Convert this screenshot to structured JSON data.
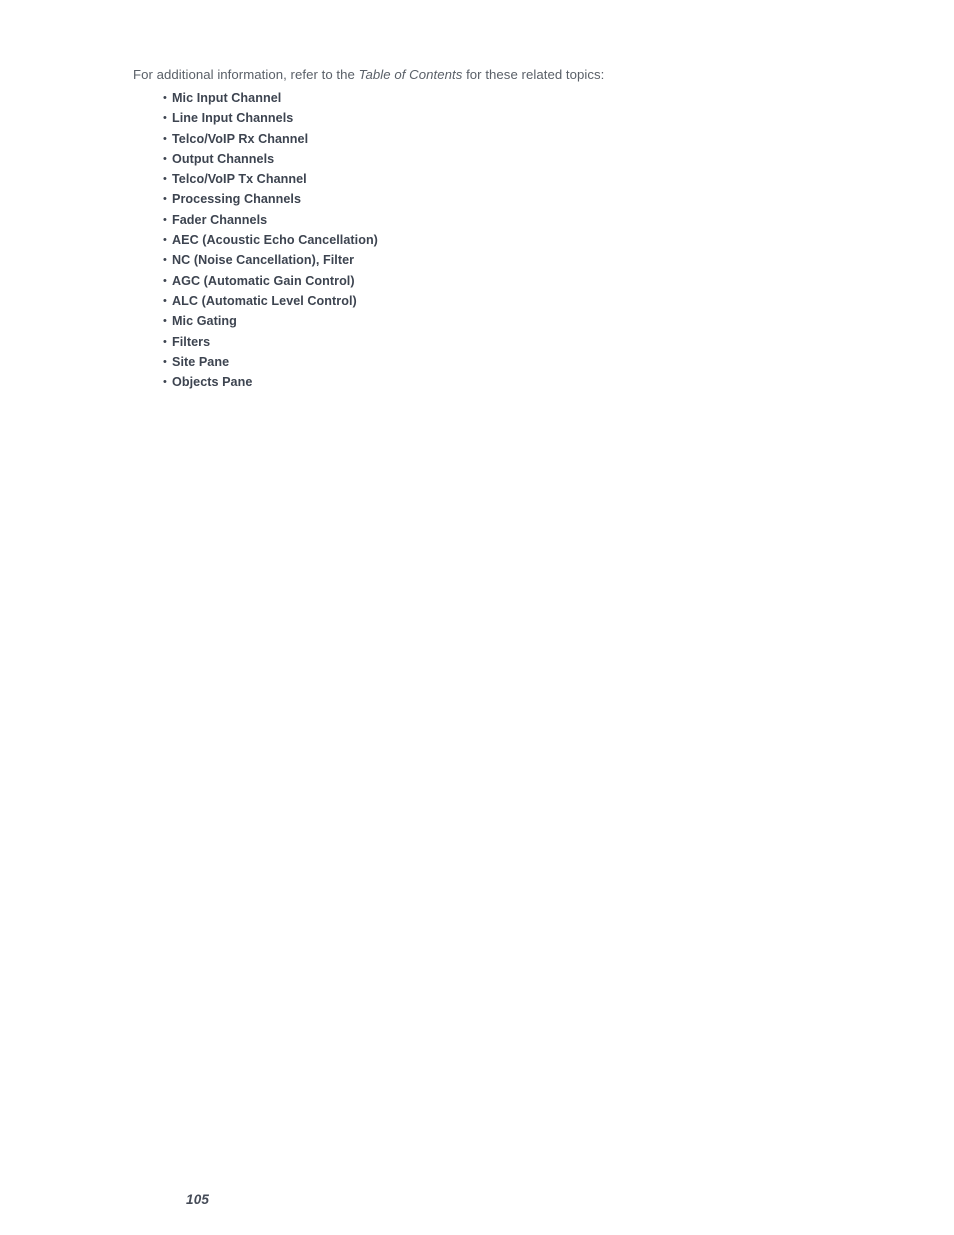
{
  "document": {
    "page_number": "105",
    "background_color": "#ffffff",
    "body_text_color": "#5a6068",
    "heading_text_color": "#3d4450"
  },
  "intro": {
    "before_emphasis": "For additional information, refer to the ",
    "emphasis": "Table of Contents",
    "after_emphasis": " for these related topics:"
  },
  "topics": {
    "bullet_glyph": "•",
    "items": [
      {
        "label": "Mic Input Channel"
      },
      {
        "label": "Line Input Channels"
      },
      {
        "label": "Telco/VoIP Rx Channel"
      },
      {
        "label": "Output Channels"
      },
      {
        "label": "Telco/VoIP Tx Channel"
      },
      {
        "label": "Processing Channels"
      },
      {
        "label": "Fader Channels"
      },
      {
        "label": "AEC (Acoustic Echo Cancellation)"
      },
      {
        "label": "NC (Noise Cancellation), Filter"
      },
      {
        "label": "AGC (Automatic Gain Control)"
      },
      {
        "label": "ALC (Automatic Level Control)"
      },
      {
        "label": "Mic Gating"
      },
      {
        "label": "Filters"
      },
      {
        "label": "Site Pane"
      },
      {
        "label": "Objects Pane"
      }
    ]
  }
}
